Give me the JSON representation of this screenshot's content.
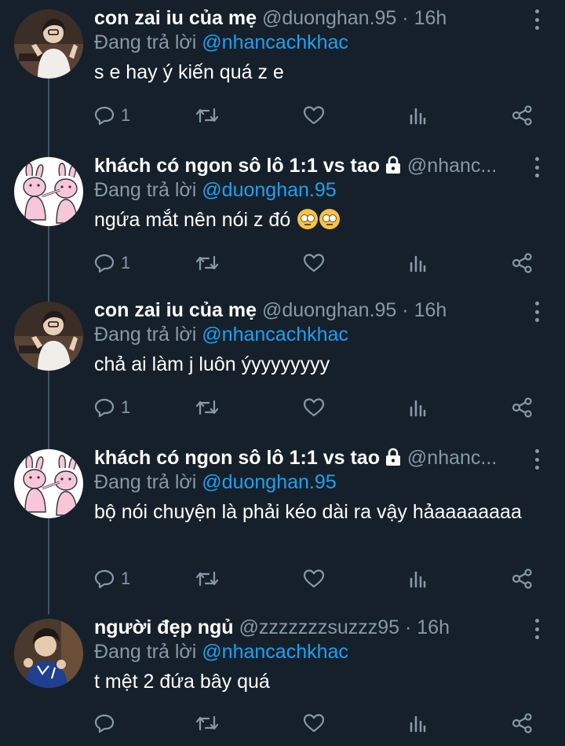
{
  "tweets": [
    {
      "name": "con zai iu của mẹ",
      "locked": false,
      "handle": "@duonghan.95",
      "time": "16h",
      "replying_prefix": "Đang trả lời",
      "replying_to": "@nhancachkhac",
      "text": "s e hay ý kiến quá z e",
      "emoji_count": 0,
      "reply_count": "1",
      "avatar": "photo-girl"
    },
    {
      "name": "khách có ngon sô lô 1:1 vs tao",
      "locked": true,
      "handle": "@nhanc...",
      "time": "",
      "replying_prefix": "Đang trả lời",
      "replying_to": "@duonghan.95",
      "text": "ngứa mắt nên nói z đó",
      "emoji_count": 2,
      "emoji_name": "face-with-rolling-eyes",
      "reply_count": "1",
      "avatar": "bunny-drawing"
    },
    {
      "name": "con zai iu của mẹ",
      "locked": false,
      "handle": "@duonghan.95",
      "time": "16h",
      "replying_prefix": "Đang trả lời",
      "replying_to": "@nhancachkhac",
      "text": "chả ai làm j luôn ýyyyyyyyy",
      "emoji_count": 0,
      "reply_count": "1",
      "avatar": "photo-girl"
    },
    {
      "name": "khách có ngon sô lô 1:1 vs tao",
      "locked": true,
      "handle": "@nhanc...",
      "time": "",
      "replying_prefix": "Đang trả lời",
      "replying_to": "@duonghan.95",
      "text": "bộ nói chuyện là phải kéo dài ra vậy hảaaaaaaaa",
      "emoji_count": 0,
      "reply_count": "1",
      "avatar": "bunny-drawing"
    },
    {
      "name": "người đẹp ngủ",
      "locked": false,
      "handle": "@zzzzzzzsuzzz95",
      "time": "16h",
      "replying_prefix": "Đang trả lời",
      "replying_to": "@nhancachkhac",
      "text": "t mệt 2 đứa bây quá",
      "emoji_count": 0,
      "reply_count": "",
      "avatar": "photo-boy"
    }
  ],
  "colors": {
    "background": "#15202b",
    "secondary_text": "#8899a6",
    "link": "#1da1f2",
    "thread_line": "#3d5466"
  }
}
